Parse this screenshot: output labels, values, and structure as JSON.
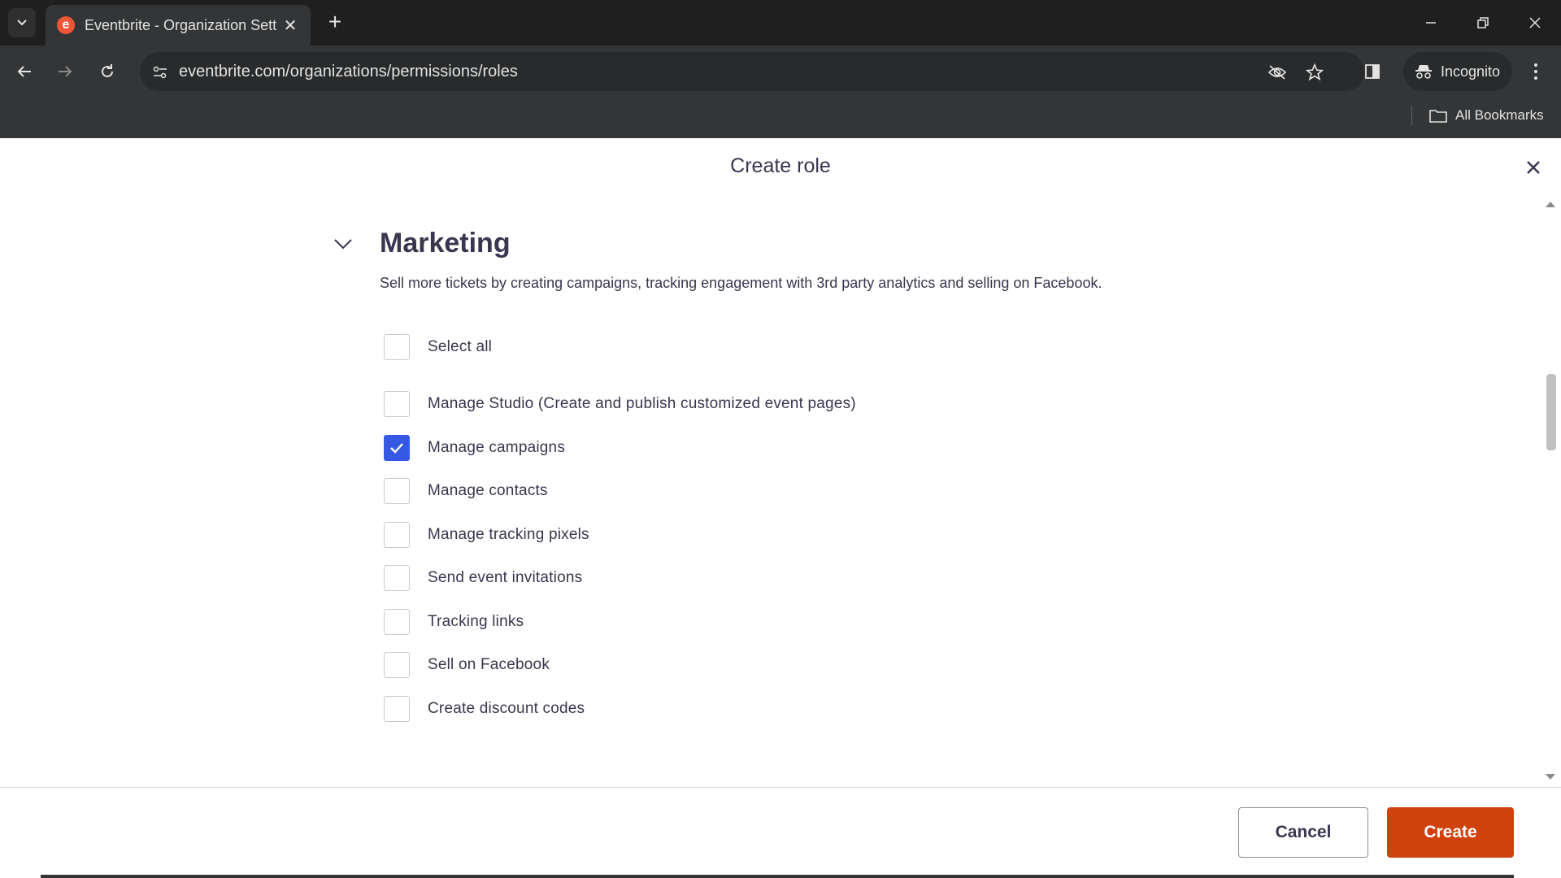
{
  "browser": {
    "tab_title": "Eventbrite - Organization Settin",
    "favicon_letter": "e",
    "url": "eventbrite.com/organizations/permissions/roles",
    "incognito_label": "Incognito",
    "all_bookmarks_label": "All Bookmarks"
  },
  "modal": {
    "title": "Create role"
  },
  "section": {
    "title": "Marketing",
    "description": "Sell more tickets by creating campaigns, tracking engagement with 3rd party analytics and selling on Facebook."
  },
  "permissions": {
    "select_all": {
      "label": "Select all",
      "checked": false
    },
    "items": [
      {
        "label": "Manage Studio (Create and publish customized event pages)",
        "checked": false
      },
      {
        "label": "Manage campaigns",
        "checked": true
      },
      {
        "label": "Manage contacts",
        "checked": false
      },
      {
        "label": "Manage tracking pixels",
        "checked": false
      },
      {
        "label": "Send event invitations",
        "checked": false
      },
      {
        "label": "Tracking links",
        "checked": false
      },
      {
        "label": "Sell on Facebook",
        "checked": false
      },
      {
        "label": "Create discount codes",
        "checked": false
      }
    ]
  },
  "footer": {
    "cancel_label": "Cancel",
    "create_label": "Create"
  },
  "colors": {
    "accent": "#d1410c",
    "checkbox_checked": "#3659e3",
    "text": "#39364f"
  }
}
